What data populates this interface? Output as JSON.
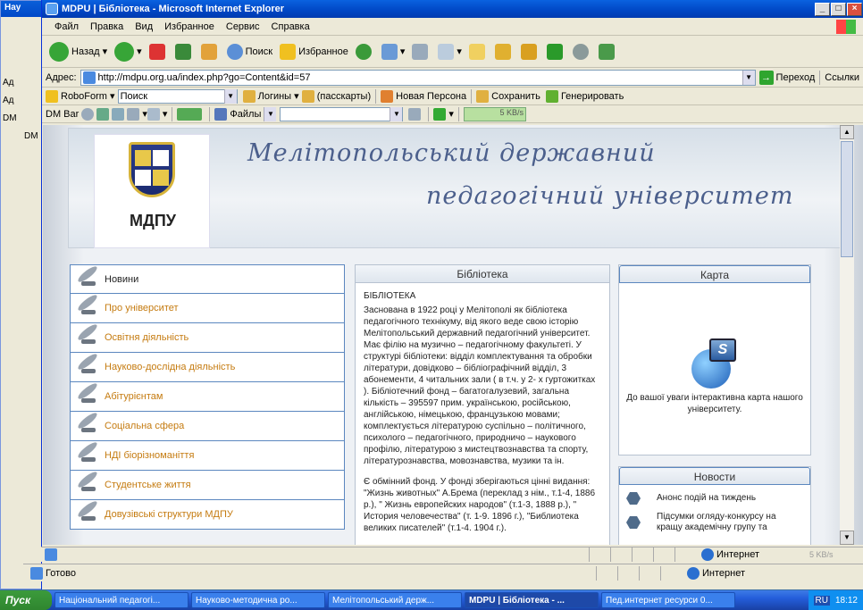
{
  "background_windows": {
    "title_fragment": "Hay",
    "rows": [
      "Ад",
      "Ад",
      "DM",
      "DM"
    ]
  },
  "window": {
    "title": "MDPU | Бібліотека - Microsoft Internet Explorer",
    "min": "_",
    "max": "□",
    "close": "×"
  },
  "menu": [
    "Файл",
    "Правка",
    "Вид",
    "Избранное",
    "Сервис",
    "Справка"
  ],
  "toolbar": {
    "back": "Назад",
    "search": "Поиск",
    "favorites": "Избранное"
  },
  "address": {
    "label": "Адрес:",
    "url": "http://mdpu.org.ua/index.php?go=Content&id=57",
    "go": "Переход",
    "links": "Ссылки"
  },
  "roboform": {
    "name": "RoboForm",
    "search_value": "Поиск",
    "logins": "Логины",
    "passcards": "(пасскарты)",
    "new_persona": "Новая Персона",
    "save": "Сохранить",
    "generate": "Генерировать"
  },
  "dmbar": {
    "name": "DM Bar",
    "files": "Файлы",
    "speed": "5 KB/s"
  },
  "header": {
    "line1": "Мелітопольський державний",
    "line2": "педагогічний університет",
    "logo_text": "МДПУ"
  },
  "nav": [
    {
      "label": "Новини",
      "style": "black"
    },
    {
      "label": "Про університет",
      "style": "orange"
    },
    {
      "label": "Освітня діяльність",
      "style": "orange"
    },
    {
      "label": "Науково-дослідна діяльність",
      "style": "orange"
    },
    {
      "label": "Абітурієнтам",
      "style": "orange"
    },
    {
      "label": "Соціальна сфера",
      "style": "orange"
    },
    {
      "label": "НДІ біорізноманіття",
      "style": "orange"
    },
    {
      "label": "Студентське життя",
      "style": "orange"
    },
    {
      "label": "Довузівські структури МДПУ",
      "style": "orange"
    }
  ],
  "library": {
    "title": "Бібліотека",
    "heading": "БІБЛІОТЕКА",
    "para1": "Заснована в 1922 році у Мелітополі як бібліотека педагогічного технікуму, від якого веде свою історію Мелітопольський державний педагогічний університет. Має філію на музично – педагогічному факультеті. У структурі бібліотеки: відділ комплектування та обробки літератури, довідково – бібліографічний відділ, 3 абонементи, 4 читальних зали ( в т.ч. у 2- х гуртожитках ). Бібліотечний фонд – багатогалузевий, загальна кількість – 395597 прим. українською, російською, англійською, німецькою, французькою мовами; комплектується літературою суспільно – політичного, психолого – педагогічного, природничо – наукового профілю, літературою з мистецтвознавства та спорту, літературознавства, мовознавства, музики та ін.",
    "para2": "Є обмінний фонд. У фонді зберігаються цінні видання: \"Жизнь животных\" А.Брема (переклад з нім., т.1-4, 1886 р.), \" Жизнь европейских народов\" (т.1-3, 1888 р.), \" История человечества\" (т. 1-9. 1896 г.), \"Библиотека великих писателей\" (т.1-4. 1904 г.)."
  },
  "map": {
    "title": "Карта",
    "text": "До вашої уваги інтерактивна карта нашого університету."
  },
  "news": {
    "title": "Новости",
    "items": [
      "Анонс подій на тиждень",
      "Підсумки огляду-конкурсу на кращу академічну групу та"
    ]
  },
  "status": {
    "internet1": "Интернет",
    "ready": "Готово",
    "internet2": "Интернет",
    "speed": "5 KB/s"
  },
  "taskbar": {
    "start": "Пуск",
    "tasks": [
      "Національний педагогі...",
      "Науково-методична ро...",
      "Мелітопольський держ...",
      "MDPU | Бібліотека - ...",
      "Пед.интернет ресурси 0..."
    ],
    "lang": "RU",
    "time": "18:12"
  },
  "colors": {
    "nav_link": "#c57b10",
    "header_text": "#4b5f8c",
    "panel_border": "#5b87bf"
  }
}
